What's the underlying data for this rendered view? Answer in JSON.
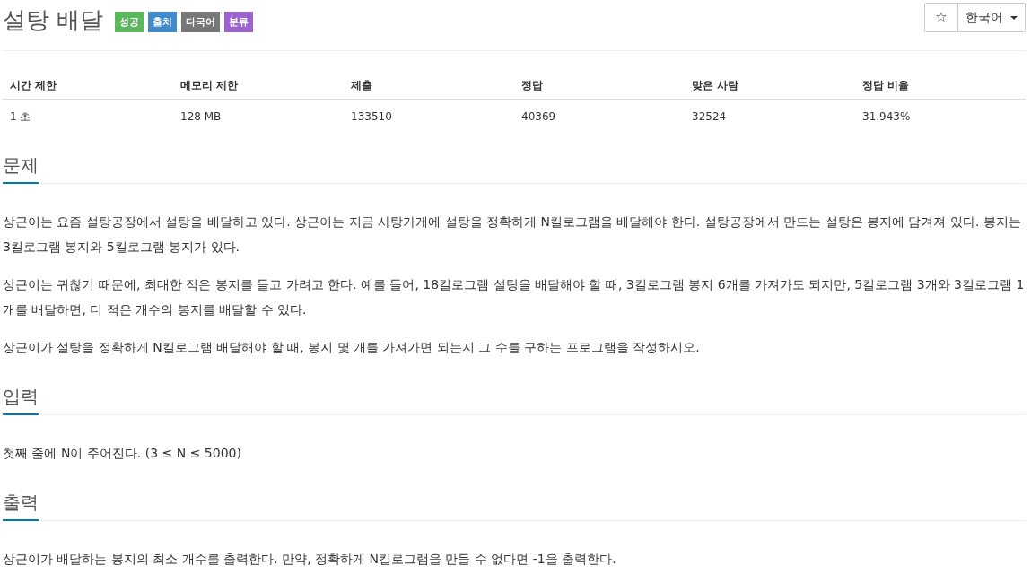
{
  "title": "설탕 배달",
  "badges": [
    {
      "label": "성공",
      "color": "#5cb85c"
    },
    {
      "label": "출처",
      "color": "#428bca"
    },
    {
      "label": "다국어",
      "color": "#777777"
    },
    {
      "label": "분류",
      "color": "#9b64cc"
    }
  ],
  "favorite_button": {
    "glyph": "☆"
  },
  "language_dropdown": {
    "label": "한국어"
  },
  "stats_table": {
    "columns": [
      "시간 제한",
      "메모리 제한",
      "제출",
      "정답",
      "맞은 사람",
      "정답 비율"
    ],
    "rows": [
      [
        "1 초",
        "128 MB",
        "133510",
        "40369",
        "32524",
        "31.943%"
      ]
    ]
  },
  "sections": [
    {
      "heading": "문제",
      "paragraphs": [
        "상근이는 요즘 설탕공장에서 설탕을 배달하고 있다. 상근이는 지금 사탕가게에 설탕을 정확하게 N킬로그램을 배달해야 한다. 설탕공장에서 만드는 설탕은 봉지에 담겨져 있다. 봉지는 3킬로그램 봉지와 5킬로그램 봉지가 있다.",
        "상근이는 귀찮기 때문에, 최대한 적은 봉지를 들고 가려고 한다. 예를 들어, 18킬로그램 설탕을 배달해야 할 때, 3킬로그램 봉지 6개를 가져가도 되지만, 5킬로그램 3개와 3킬로그램 1개를 배달하면, 더 적은 개수의 봉지를 배달할 수 있다.",
        "상근이가 설탕을 정확하게 N킬로그램 배달해야 할 때, 봉지 몇 개를 가져가면 되는지 그 수를 구하는 프로그램을 작성하시오."
      ]
    },
    {
      "heading": "입력",
      "paragraphs": [
        "첫째 줄에 N이 주어진다. (3 ≤ N ≤ 5000)"
      ]
    },
    {
      "heading": "출력",
      "paragraphs": [
        "상근이가 배달하는 봉지의 최소 개수를 출력한다. 만약, 정확하게 N킬로그램을 만들 수 없다면 -1을 출력한다."
      ]
    }
  ]
}
